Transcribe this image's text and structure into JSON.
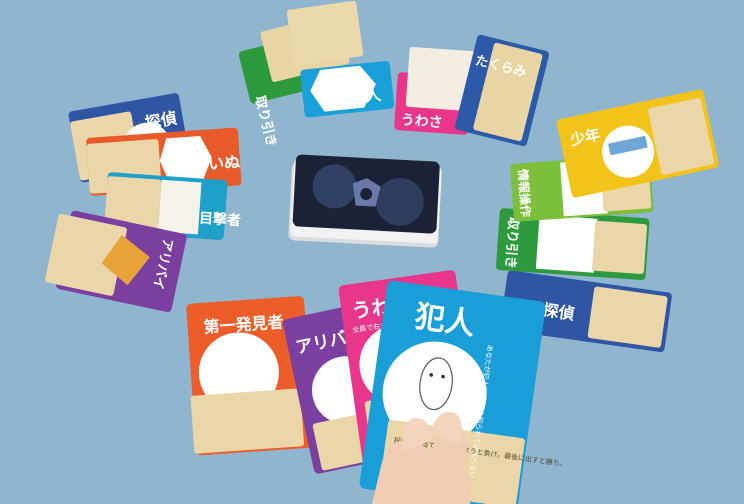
{
  "scene": {
    "background": "#8fb5cf",
    "center_deck": {
      "description_icon": "card-deck-back",
      "pattern_colors": [
        "#1c2236",
        "#3a4f7a",
        "#6a7aa8"
      ]
    }
  },
  "cards": {
    "top_row": [
      {
        "label": "取り引き",
        "color": "#2e9a3e"
      },
      {
        "label": "一般人",
        "color": "#1aa0d8"
      },
      {
        "label": "うわさ",
        "color": "#e8368a"
      },
      {
        "label": "たくらみ",
        "color": "#2c5aa8"
      }
    ],
    "left_fan": [
      {
        "label": "探偵",
        "color": "#2f55a4"
      },
      {
        "label": "いぬ",
        "color": "#e85a2a"
      },
      {
        "label": "目撃者",
        "color": "#1ea0c8"
      },
      {
        "label": "アリバイ",
        "color": "#7b3fa0"
      }
    ],
    "right_fan": [
      {
        "label": "少年",
        "color": "#f2c419"
      },
      {
        "label": "情報操作",
        "color": "#7cbf3a"
      },
      {
        "label": "取り引き",
        "color": "#2e9a3e"
      },
      {
        "label": "探偵",
        "color": "#2f55a4"
      }
    ],
    "hand": [
      {
        "label": "第一発見者",
        "color": "#ec5d2a"
      },
      {
        "label": "アリバイ",
        "color": "#7b3fa0"
      },
      {
        "label": "うわさ",
        "color": "#e8368a",
        "subtitle": "全員で右から1枚ひく"
      },
      {
        "label": "犯人",
        "color": "#1a9ed8",
        "subtitle": "あなたが犯人だ 真相を知られてはならない",
        "note": "探偵に言当てられてしまうと負け。最後に出すと勝ち。"
      }
    ]
  }
}
